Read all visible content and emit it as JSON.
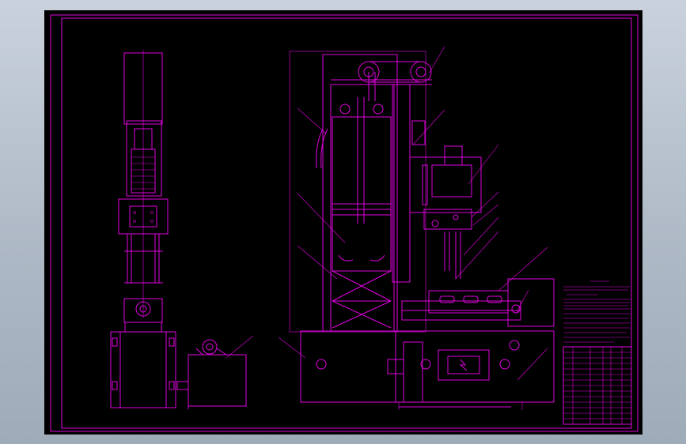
{
  "drawing": {
    "background": "#000000",
    "line_color": "#e000e0",
    "canvas_bg": "#aeb9c6",
    "title_block": {
      "rows": 14
    }
  }
}
